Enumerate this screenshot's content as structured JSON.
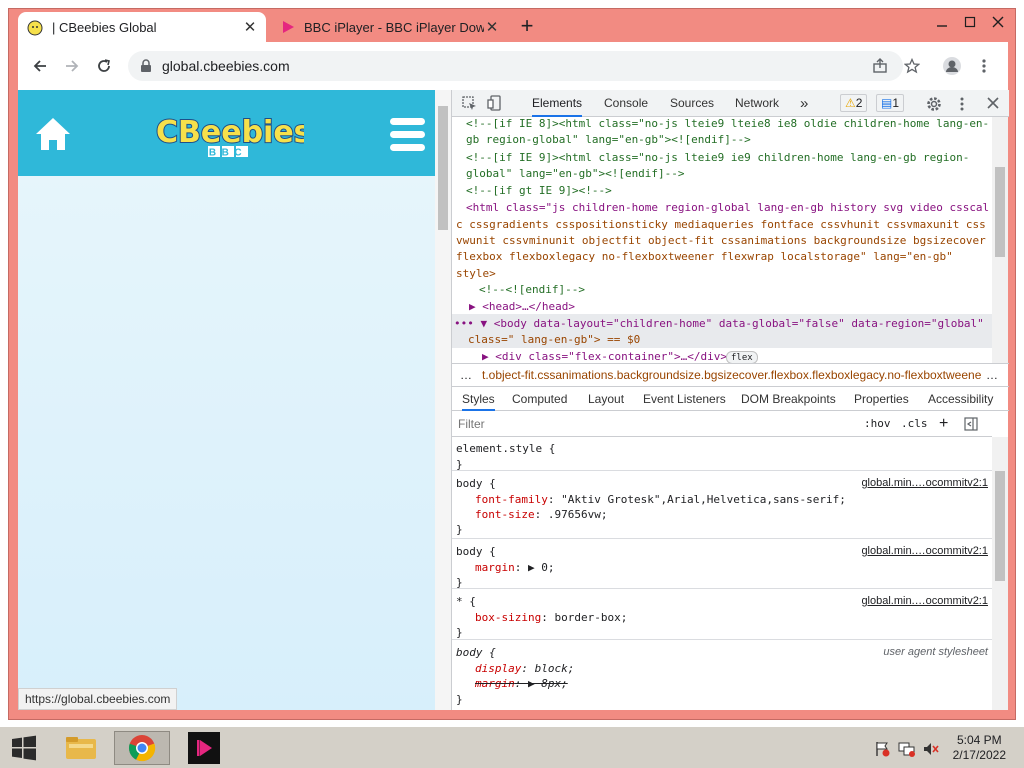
{
  "tabs": [
    {
      "title": "| CBeebies Global",
      "active": true
    },
    {
      "title": "BBC iPlayer - BBC iPlayer Downlo",
      "active": false
    }
  ],
  "address": {
    "url": "global.cbeebies.com"
  },
  "page": {
    "brand": "CBeebies",
    "brand_sub": "BBC",
    "status_url": "https://global.cbeebies.com"
  },
  "devtools": {
    "tabs": [
      "Elements",
      "Console",
      "Sources",
      "Network"
    ],
    "more": "»",
    "warnings": "2",
    "messages": "1",
    "dom_lines": [
      "<!--[if IE 8]><html class=\"no-js lteie9 lteie8 ie8 oldie children-home lang-en-",
      "gb region-global\" lang=\"en-gb\"><![endif]-->",
      "<!--[if IE 9]><html class=\"no-js lteie9 ie9 children-home lang-en-gb region-",
      "global\" lang=\"en-gb\"><![endif]-->",
      "<!--[if gt IE 9]><!-->",
      "<html class=\"js children-home region-global lang-en-gb history svg video csscal",
      "c cssgradients csspositionsticky mediaqueries fontface cssvhunit cssvmaxunit css",
      "vwunit cssvminunit objectfit object-fit cssanimations backgroundsize bgsizecover",
      "flexbox flexboxlegacy no-flexboxtweener flexwrap localstorage\" lang=\"en-gb\"",
      "style>",
      "<!--<![endif]-->",
      "▶ <head>…</head>",
      "••• ▼ <body data-layout=\"children-home\" data-global=\"false\" data-region=\"global\"",
      "class=\" lang-en-gb\"> == $0",
      "▶ <div class=\"flex-container\">…</div>"
    ],
    "flex_badge": "flex",
    "breadcrumb": "t.object-fit.cssanimations.backgroundsize.bgsizecover.flexbox.flexboxlegacy.no-flexboxtweener",
    "styles_tabs": [
      "Styles",
      "Computed",
      "Layout",
      "Event Listeners",
      "DOM Breakpoints",
      "Properties",
      "Accessibility"
    ],
    "filter_placeholder": "Filter",
    "hov": ":hov",
    "cls": ".cls",
    "rules": [
      {
        "selector": "element.style {",
        "source": "",
        "decls": [],
        "close": "}"
      },
      {
        "selector": "body {",
        "source": "global.min.…ocommitv2:1",
        "decls": [
          {
            "p": "font-family",
            "v": "\"Aktiv Grotesk\",Arial,Helvetica,sans-serif;"
          },
          {
            "p": "font-size",
            "v": ".97656vw;"
          }
        ],
        "close": "}"
      },
      {
        "selector": "body {",
        "source": "global.min.…ocommitv2:1",
        "decls": [
          {
            "p": "margin",
            "v": "▶ 0;"
          }
        ],
        "close": "}"
      },
      {
        "selector": "* {",
        "source": "global.min.…ocommitv2:1",
        "decls": [
          {
            "p": "box-sizing",
            "v": "border-box;"
          }
        ],
        "close": "}"
      },
      {
        "selector": "body {",
        "source": "user agent stylesheet",
        "decls": [
          {
            "p": "display",
            "v": "block;"
          },
          {
            "p": "margin",
            "v": "▶ 8px;"
          }
        ],
        "close": "}"
      }
    ]
  },
  "clock": {
    "time": "5:04 PM",
    "date": "2/17/2022"
  }
}
